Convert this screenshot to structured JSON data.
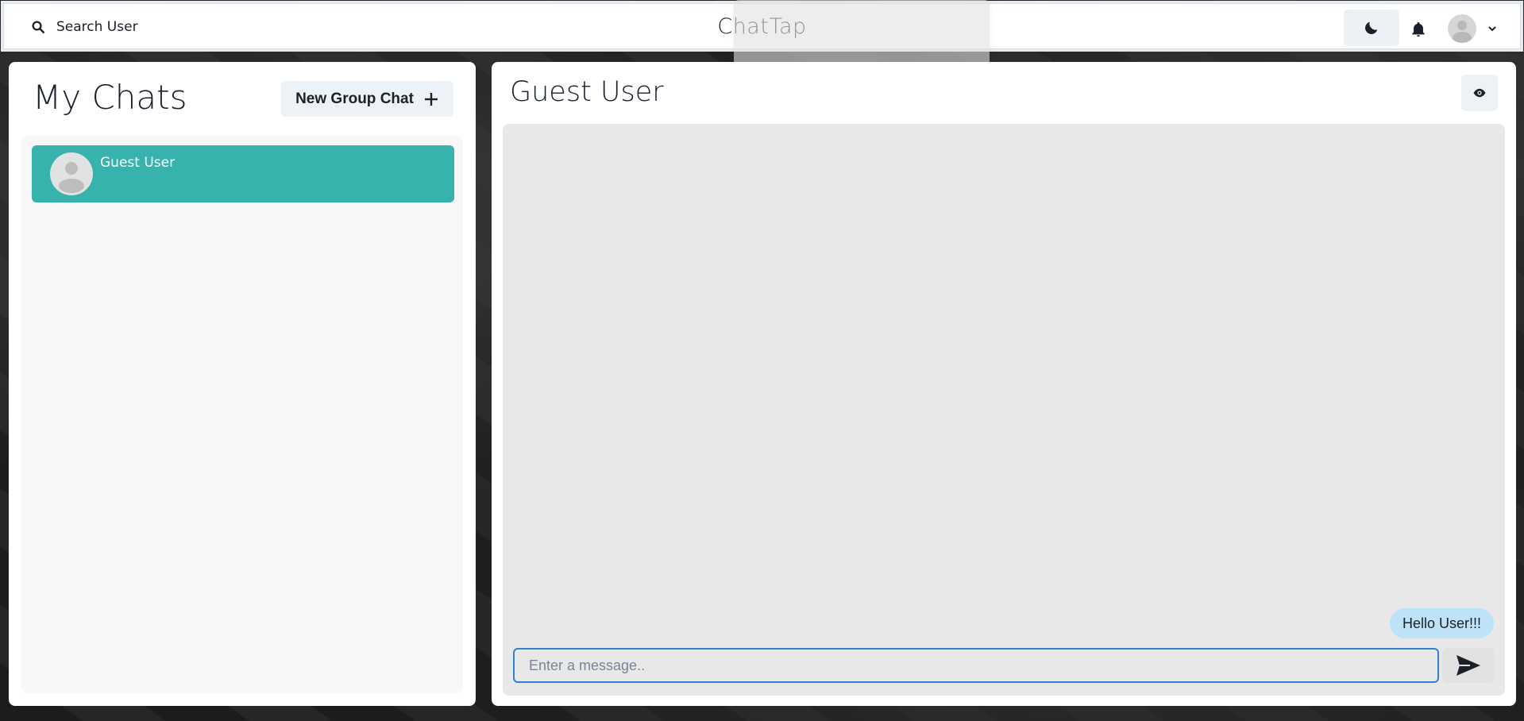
{
  "header": {
    "search_label": "Search User",
    "app_title": "ChatTap",
    "search_icon": "search-icon",
    "theme_icon": "moon-icon",
    "notification_icon": "bell-icon",
    "user_menu_icon": "chevron-down-icon"
  },
  "left_panel": {
    "title": "My Chats",
    "new_group_label": "New Group Chat",
    "new_group_icon": "plus-icon",
    "chats": [
      {
        "name": "Guest User",
        "selected": true
      }
    ]
  },
  "right_panel": {
    "title": "Guest User",
    "view_icon": "eye-icon",
    "messages": [
      {
        "text": "Hello User!!!",
        "own": true
      }
    ],
    "input_placeholder": "Enter a message..",
    "send_icon": "send-icon"
  },
  "colors": {
    "selected_chat": "#38b2ac",
    "own_bubble": "#bee3f8",
    "input_focus": "#3182ce"
  }
}
